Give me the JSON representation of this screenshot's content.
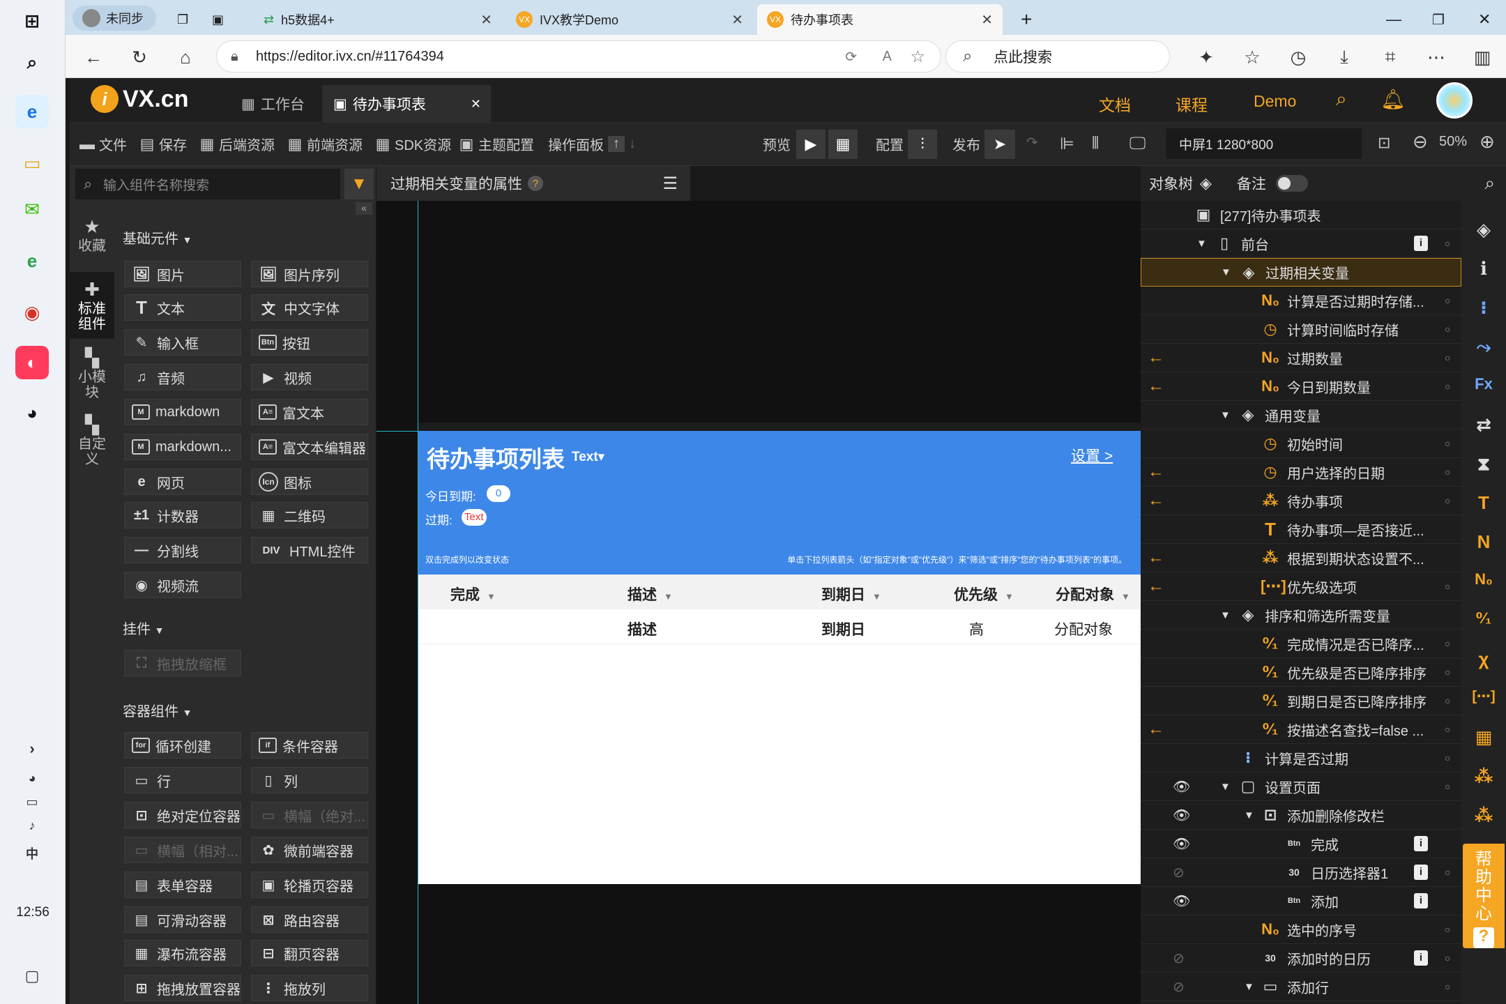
{
  "os": {
    "clock": "12:56",
    "apps": [
      "windows-icon",
      "search-icon",
      "edge-icon",
      "explorer-icon",
      "wechat-icon",
      "ie-icon",
      "chrome-icon",
      "app-icon",
      "qq-icon"
    ]
  },
  "browser": {
    "profile": "未同步",
    "tabs": [
      {
        "label": "h5数据4+"
      },
      {
        "label": "IVX教学Demo"
      },
      {
        "label": "待办事项表"
      }
    ],
    "url": "https://editor.ivx.cn/#11764394",
    "search_placeholder": "点此搜索"
  },
  "app": {
    "logo": "VX.cn",
    "tabs": [
      {
        "label": "工作台"
      },
      {
        "label": "待办事项表"
      }
    ],
    "header_links": [
      "文档",
      "课程",
      "Demo"
    ]
  },
  "toolbar": {
    "file": "文件",
    "save": "保存",
    "backend": "后端资源",
    "frontend": "前端资源",
    "sdk": "SDK资源",
    "theme": "主题配置",
    "ops": "操作面板",
    "preview": "预览",
    "config": "配置",
    "publish": "发布",
    "screen": "中屏1 1280*800",
    "zoom": "50%"
  },
  "sidebar": {
    "items": [
      {
        "label": "收藏"
      },
      {
        "label": "标准组件"
      },
      {
        "label": "小模块"
      },
      {
        "label": "自定义"
      }
    ]
  },
  "components": {
    "search_placeholder": "输入组件名称搜索",
    "groups": {
      "basic": "基础元件",
      "widgets": "挂件",
      "containers": "容器组件"
    },
    "basic": [
      "图片",
      "图片序列",
      "文本",
      "中文字体",
      "输入框",
      "按钮",
      "音频",
      "视频",
      "markdown",
      "富文本",
      "markdown...",
      "富文本编辑器",
      "网页",
      "图标",
      "计数器",
      "二维码",
      "分割线",
      "HTML控件",
      "视频流"
    ],
    "widgets": [
      "拖拽放缩框"
    ],
    "containers": [
      "循环创建",
      "条件容器",
      "行",
      "列",
      "绝对定位容器",
      "横幅（绝对...",
      "横幅（相对...",
      "微前端容器",
      "表单容器",
      "轮播页容器",
      "可滑动容器",
      "路由容器",
      "瀑布流容器",
      "翻页容器",
      "拖拽放置容器",
      "拖放列"
    ]
  },
  "props": {
    "title": "过期相关变量的属性"
  },
  "preview": {
    "title": "待办事项列表",
    "title_tag": "Text▾",
    "settings_link": "设置 >",
    "today_label": "今日到期:",
    "today_count": "0",
    "overdue_label": "过期:",
    "overdue_value": "Text",
    "hint_left": "双击完成列以改变状态",
    "hint_right": "单击下拉列表箭头（如\"指定对象\"或\"优先级\"）来\"筛选\"或\"排序\"您的\"待办事项列表\"的事项。",
    "columns": [
      "完成",
      "描述",
      "到期日",
      "优先级",
      "分配对象"
    ],
    "row": [
      "描述",
      "到期日",
      "高",
      "分配对象"
    ]
  },
  "tree": {
    "head": "对象树",
    "note": "备注",
    "rows": [
      {
        "label": "[277]待办事项表"
      },
      {
        "label": "前台"
      },
      {
        "label": "过期相关变量"
      },
      {
        "label": "计算是否过期时存储..."
      },
      {
        "label": "计算时间临时存储"
      },
      {
        "label": "过期数量"
      },
      {
        "label": "今日到期数量"
      },
      {
        "label": "通用变量"
      },
      {
        "label": "初始时间"
      },
      {
        "label": "用户选择的日期"
      },
      {
        "label": "待办事项"
      },
      {
        "label": "待办事项—是否接近..."
      },
      {
        "label": "根据到期状态设置不..."
      },
      {
        "label": "优先级选项"
      },
      {
        "label": "排序和筛选所需变量"
      },
      {
        "label": "完成情况是否已降序..."
      },
      {
        "label": "优先级是否已降序排序"
      },
      {
        "label": "到期日是否已降序排序"
      },
      {
        "label": "按描述名查找=false ..."
      },
      {
        "label": "计算是否过期"
      },
      {
        "label": "设置页面"
      },
      {
        "label": "添加删除修改栏"
      },
      {
        "label": "完成"
      },
      {
        "label": "日历选择器1"
      },
      {
        "label": "添加"
      },
      {
        "label": "选中的序号"
      },
      {
        "label": "添加时的日历"
      },
      {
        "label": "添加行"
      }
    ]
  },
  "help": "帮助中心",
  "colors": {
    "accent": "#f5a623",
    "preview_blue": "#3d87e8"
  }
}
